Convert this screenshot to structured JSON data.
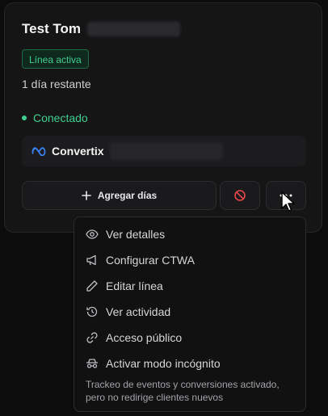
{
  "card": {
    "title": "Test Tom",
    "badge": "Línea activa",
    "remaining": "1 día restante",
    "status": "Conectado",
    "account_name": "Convertix",
    "add_days_label": "Agregar días"
  },
  "menu": {
    "items": [
      {
        "label": "Ver detalles",
        "icon": "eye-icon"
      },
      {
        "label": "Configurar CTWA",
        "icon": "megaphone-icon"
      },
      {
        "label": "Editar línea",
        "icon": "pencil-icon"
      },
      {
        "label": "Ver actividad",
        "icon": "history-icon"
      },
      {
        "label": "Acceso público",
        "icon": "link-icon"
      },
      {
        "label": "Activar modo incógnito",
        "icon": "incognito-icon"
      }
    ],
    "note": "Trackeo de eventos y conversiones activado, pero no redirige clientes nuevos"
  },
  "colors": {
    "accent_green": "#3ecf8e",
    "danger": "#e5484d",
    "meta_blue": "#3b82f6"
  }
}
